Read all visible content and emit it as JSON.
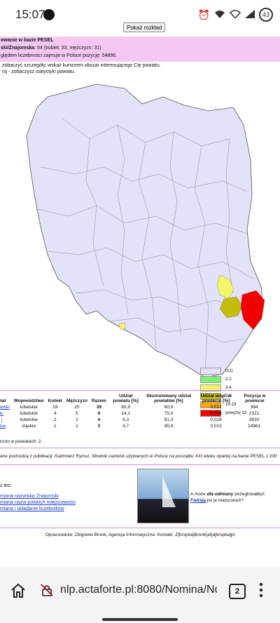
{
  "status": {
    "time": "15:07",
    "battery": "43"
  },
  "page": {
    "show_layout_button": "Pokaż rozkład",
    "header_title": "owanie w bazie PESEL",
    "header_line1_name": "ski/Znajomska",
    "header_line1_rest": ": 64 (kobiet: 33, mężczyzn: 31)",
    "header_line2": "ględem liczebności zajmuje w Polsce pozycję: 54896.",
    "hint1": "zobaczyć szczegóły, wskaż kursorem obszar interesującego Cię powiatu.",
    "hint2": "nij - zobaczysz statystyki powiatu."
  },
  "legend": [
    {
      "label": "0(1)",
      "color": "#e2e2f8"
    },
    {
      "label": "2-2",
      "color": "#7cf070"
    },
    {
      "label": "3-4",
      "color": "#f5f56a"
    },
    {
      "label": "5-9",
      "color": "#c4bb0a"
    },
    {
      "label": "10-19",
      "color": "#f7a800"
    },
    {
      "label": "powyżej 19",
      "color": "#f00000"
    }
  ],
  "table": {
    "headers": [
      "wiat",
      "Województwo",
      "Kobiet",
      "Mężczyzn",
      "Razem",
      "Udział powiatu [%]",
      "Skumulowany udział powiatów [%]",
      "Udział wzgl. w powiecie [%]",
      "Pozycja w powiecie"
    ],
    "rows": [
      {
        "powiat": "szowski",
        "woj": "lubelskie",
        "k": "19",
        "m": "20",
        "r": "39",
        "u": "60,9",
        "s": "60,9",
        "w": "0,512",
        "p": "384."
      },
      {
        "powiat": "ki",
        "woj": "lubelskie",
        "k": "4",
        "m": "5",
        "r": "9",
        "u": "14,1",
        "s": "75,0",
        "w": "0,078",
        "p": "2321."
      },
      {
        "powiat": "i",
        "woj": "lubelskie",
        "k": "2",
        "m": "2",
        "r": "4",
        "u": "6,3",
        "s": "81,3",
        "w": "0,028",
        "p": "3830."
      },
      {
        "powiat": "vice",
        "woj": "śląskie",
        "k": "1",
        "m": "2",
        "r": "3",
        "u": "4,7",
        "s": "85,9",
        "w": "0,013",
        "p": "14961."
      }
    ],
    "note": "nczo w powiatach: 2."
  },
  "source": {
    "prefix": "ane pochodzą z publikacji: ",
    "author": "Kazimierz Rymut",
    "comma": ", ",
    "title": "Słownik nazwisk używanych w Polsce na początku XXI wieku",
    "suffix": " opartej na bazie PESEL z 200"
  },
  "see_also": {
    "heading": "z też:",
    "links": [
      "mianа nazwiska Znajomski",
      "miana nazw polskich miejscowości",
      "miana i składanie liczebników"
    ]
  },
  "promo": {
    "text_before": "A może ",
    "em": "dla odmiany",
    "text_mid": " pożeglowałbyś ",
    "link": "Fleksją",
    "text_after": " po je mazurskich?"
  },
  "footer": "Opracowanie: Zbigniew Bronk, Agencja Informatyczna. Kontakt: Z[kropka]Bronk[at]a[kropka]pl",
  "browser": {
    "url": "nlp.actaforte.pl:8080/Nomina/No",
    "tabs_count": "2"
  }
}
